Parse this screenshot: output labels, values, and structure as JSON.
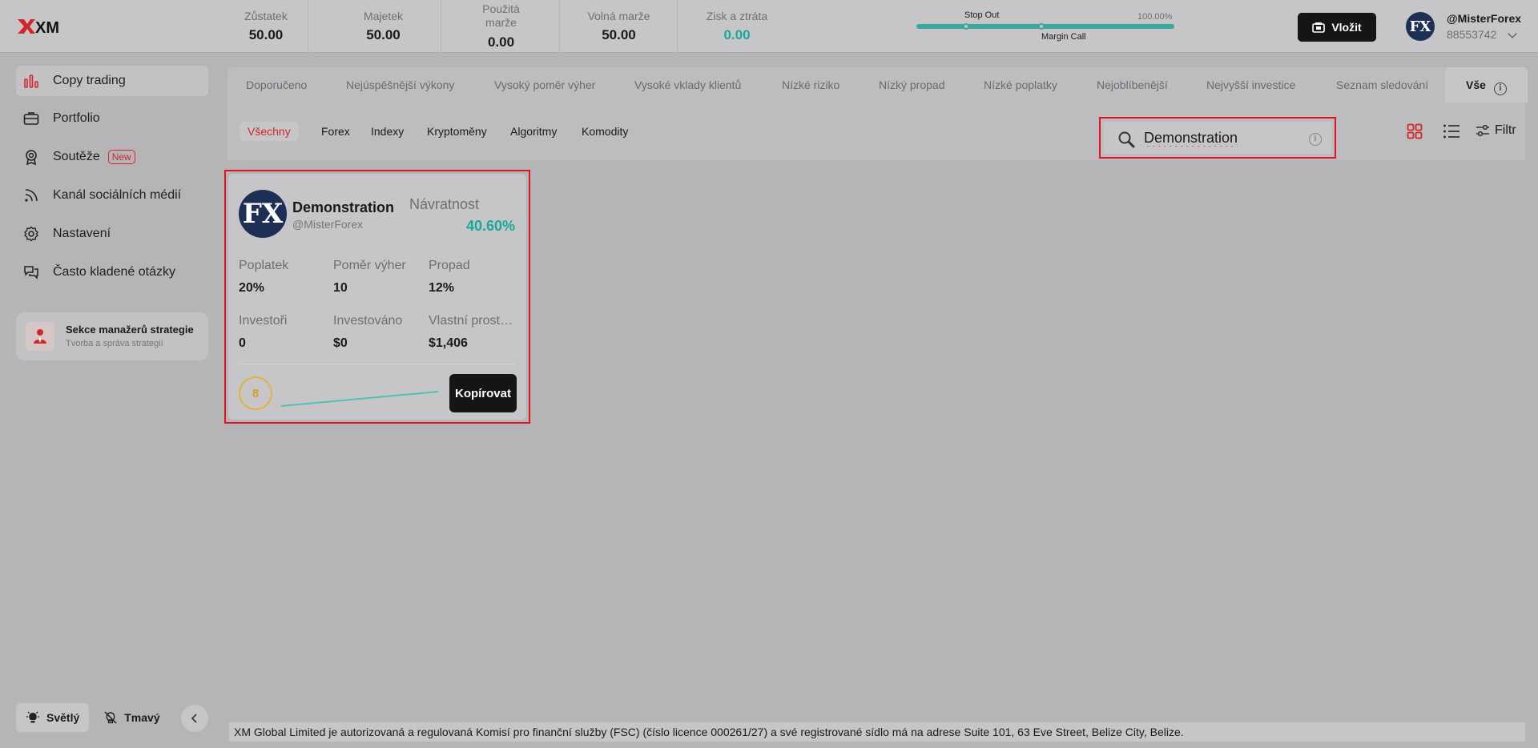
{
  "header": {
    "logo_text": "XM",
    "metrics": [
      {
        "label": "Zůstatek",
        "value": "50.00"
      },
      {
        "label": "Majetek",
        "value": "50.00"
      },
      {
        "label": "Použitá marže",
        "value": "0.00"
      },
      {
        "label": "Volná marže",
        "value": "50.00"
      },
      {
        "label": "Zisk a ztráta",
        "value": "0.00"
      }
    ],
    "margin": {
      "stop_out": "Stop Out",
      "percent": "100.00%",
      "margin_call": "Margin Call"
    },
    "deposit_label": "Vložit",
    "user": {
      "avatar": "FX",
      "name": "@MisterForex",
      "id": "88553742"
    }
  },
  "sidebar": {
    "items": [
      {
        "label": "Copy trading"
      },
      {
        "label": "Portfolio"
      },
      {
        "label": "Soutěže",
        "badge": "New"
      },
      {
        "label": "Kanál sociálních médií"
      },
      {
        "label": "Nastavení"
      },
      {
        "label": "Často kladené otázky"
      }
    ],
    "manager": {
      "title": "Sekce manažerů strategie",
      "subtitle": "Tvorba a správa strategií"
    },
    "theme": {
      "light": "Světlý",
      "dark": "Tmavý"
    }
  },
  "tabs": [
    "Doporučeno",
    "Nejúspěšnější výkony",
    "Vysoký poměr výher",
    "Vysoké vklady klientů",
    "Nízké riziko",
    "Nízký propad",
    "Nízké poplatky",
    "Nejoblíbenější",
    "Nejvyšší investice",
    "Seznam sledování",
    "Vše"
  ],
  "categories": [
    "Všechny",
    "Forex",
    "Indexy",
    "Kryptoměny",
    "Algoritmy",
    "Komodity"
  ],
  "search": {
    "value": "Demonstration",
    "placeholder": ""
  },
  "filter_label": "Filtr",
  "card": {
    "avatar": "FX",
    "name": "Demonstration",
    "handle": "@MisterForex",
    "return_label": "Návratnost",
    "return_value": "40.60%",
    "stats": [
      {
        "label": "Poplatek",
        "value": "20%"
      },
      {
        "label": "Poměr výher",
        "value": "10"
      },
      {
        "label": "Propad",
        "value": "12%"
      },
      {
        "label": "Investoři",
        "value": "0"
      },
      {
        "label": "Investováno",
        "value": "$0"
      },
      {
        "label": "Vlastní prostředky",
        "value": "$1,406"
      }
    ],
    "score": "8",
    "copy_label": "Kopírovat"
  },
  "footer": "XM Global Limited je autorizovaná a regulovaná Komisí pro finanční služby (FSC) (číslo licence 000261/27) a své registrované sídlo má na adrese Suite 101, 63 Eve Street, Belize City, Belize.",
  "colors": {
    "accent": "#e3131b",
    "positive": "#1aa89b",
    "score": "#e3b23a"
  }
}
